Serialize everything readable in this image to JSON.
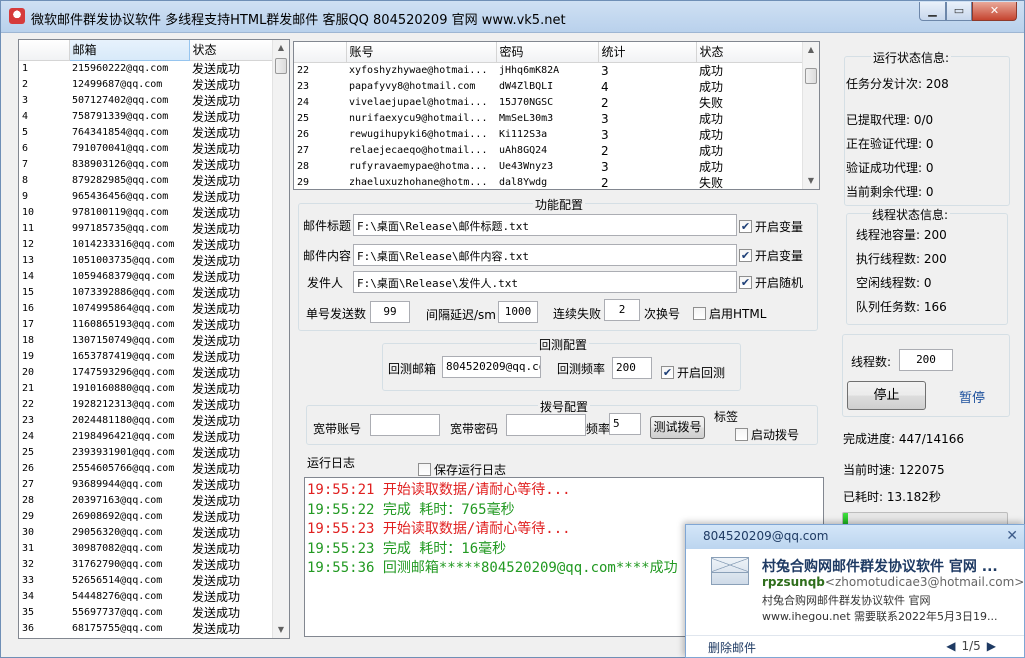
{
  "window": {
    "title": "微软邮件群发协议软件 多线程支持HTML群发邮件 客服QQ 804520209 官网 www.vk5.net"
  },
  "left_list": {
    "columns": [
      "",
      "邮箱",
      "状态"
    ],
    "rows": [
      [
        "1",
        "215960222@qq.com",
        "发送成功"
      ],
      [
        "2",
        "12499687@qq.com",
        "发送成功"
      ],
      [
        "3",
        "507127402@qq.com",
        "发送成功"
      ],
      [
        "4",
        "758791339@qq.com",
        "发送成功"
      ],
      [
        "5",
        "764341854@qq.com",
        "发送成功"
      ],
      [
        "6",
        "791070041@qq.com",
        "发送成功"
      ],
      [
        "7",
        "838903126@qq.com",
        "发送成功"
      ],
      [
        "8",
        "879282985@qq.com",
        "发送成功"
      ],
      [
        "9",
        "965436456@qq.com",
        "发送成功"
      ],
      [
        "10",
        "978100119@qq.com",
        "发送成功"
      ],
      [
        "11",
        "997185735@qq.com",
        "发送成功"
      ],
      [
        "12",
        "1014233316@qq.com",
        "发送成功"
      ],
      [
        "13",
        "1051003735@qq.com",
        "发送成功"
      ],
      [
        "14",
        "1059468379@qq.com",
        "发送成功"
      ],
      [
        "15",
        "1073392886@qq.com",
        "发送成功"
      ],
      [
        "16",
        "1074995864@qq.com",
        "发送成功"
      ],
      [
        "17",
        "1160865193@qq.com",
        "发送成功"
      ],
      [
        "18",
        "1307150749@qq.com",
        "发送成功"
      ],
      [
        "19",
        "1653787419@qq.com",
        "发送成功"
      ],
      [
        "20",
        "1747593296@qq.com",
        "发送成功"
      ],
      [
        "21",
        "1910160880@qq.com",
        "发送成功"
      ],
      [
        "22",
        "1928212313@qq.com",
        "发送成功"
      ],
      [
        "23",
        "2024481180@qq.com",
        "发送成功"
      ],
      [
        "24",
        "2198496421@qq.com",
        "发送成功"
      ],
      [
        "25",
        "2393931901@qq.com",
        "发送成功"
      ],
      [
        "26",
        "2554605766@qq.com",
        "发送成功"
      ],
      [
        "27",
        "93689944@qq.com",
        "发送成功"
      ],
      [
        "28",
        "20397163@qq.com",
        "发送成功"
      ],
      [
        "29",
        "26908692@qq.com",
        "发送成功"
      ],
      [
        "30",
        "29056320@qq.com",
        "发送成功"
      ],
      [
        "31",
        "30987082@qq.com",
        "发送成功"
      ],
      [
        "32",
        "31762790@qq.com",
        "发送成功"
      ],
      [
        "33",
        "52656514@qq.com",
        "发送成功"
      ],
      [
        "34",
        "54448276@qq.com",
        "发送成功"
      ],
      [
        "35",
        "55697737@qq.com",
        "发送成功"
      ],
      [
        "36",
        "68175755@qq.com",
        "发送成功"
      ]
    ]
  },
  "account_list": {
    "columns": [
      "",
      "账号",
      "密码",
      "统计",
      "状态"
    ],
    "rows": [
      [
        "22",
        "xyfoshyzhywae@hotmai...",
        "jHhq6mK82A",
        "3",
        "成功"
      ],
      [
        "23",
        "papafyvy8@hotmail.com",
        "dW4ZlBQLI",
        "4",
        "成功"
      ],
      [
        "24",
        "vivelaejupael@hotmai...",
        "15J70NGSC",
        "2",
        "失败"
      ],
      [
        "25",
        "nurifaexycu9@hotmail...",
        "MmSeL30m3",
        "3",
        "成功"
      ],
      [
        "26",
        "rewugihupyki6@hotmai...",
        "Ki112S3a",
        "3",
        "成功"
      ],
      [
        "27",
        "relaejecaeqo@hotmail...",
        "uAh8GQ24",
        "2",
        "成功"
      ],
      [
        "28",
        "rufyravaemypae@hotma...",
        "Ue43Wnyz3",
        "3",
        "成功"
      ],
      [
        "29",
        "zhaeluxuzhohane@hotm...",
        "dal8Ywdg",
        "2",
        "失败"
      ]
    ]
  },
  "func_config": {
    "title": "功能配置",
    "subject_label": "邮件标题",
    "subject_path": "F:\\桌面\\Release\\邮件标题.txt",
    "subject_var": "开启变量",
    "content_label": "邮件内容",
    "content_path": "F:\\桌面\\Release\\邮件内容.txt",
    "content_var": "开启变量",
    "sender_label": "发件人",
    "sender_path": "F:\\桌面\\Release\\发件人.txt",
    "sender_rand": "开启随机",
    "single_send_label": "单号发送数",
    "single_send_value": "99",
    "interval_label": "间隔延迟/sm",
    "interval_value": "1000",
    "fail_label": "连续失败",
    "fail_value": "2",
    "switch_label": "次换号",
    "html_label": "启用HTML"
  },
  "return_config": {
    "title": "回测配置",
    "email_label": "回测邮箱",
    "email_value": "804520209@qq.com",
    "freq_label": "回测频率",
    "freq_value": "200",
    "enable_label": "开启回测"
  },
  "dial_config": {
    "title": "拨号配置",
    "account_label": "宽带账号",
    "account_value": "",
    "password_label": "宽带密码",
    "password_value": "",
    "freq_label": "频率",
    "freq_value": "5",
    "test_button": "测试拨号",
    "tag_label": "标签",
    "enable_label": "启动拨号"
  },
  "log": {
    "title": "运行日志",
    "save_label": "保存运行日志",
    "lines": [
      {
        "text": "19:55:21 开始读取数据/请耐心等待...",
        "color": "#e02020"
      },
      {
        "text": "19:55:22 完成 耗时：765毫秒",
        "color": "#229922"
      },
      {
        "text": "19:55:23 开始读取数据/请耐心等待...",
        "color": "#e02020"
      },
      {
        "text": "19:55:23 完成 耗时：16毫秒",
        "color": "#229922"
      },
      {
        "text": "19:55:36 回测邮箱*****804520209@qq.com****成功",
        "color": "#229922"
      }
    ]
  },
  "run_status": {
    "title": "运行状态信息:",
    "dispatch": "任务分发计次: 208",
    "proxy_fetched": "已提取代理: 0/0",
    "proxy_verifying": "正在验证代理: 0",
    "proxy_ok": "验证成功代理: 0",
    "proxy_left": "当前剩余代理: 0"
  },
  "thread_status": {
    "title": "线程状态信息:",
    "pool": "线程池容量: 200",
    "running": "执行线程数: 200",
    "idle": "空闲线程数: 0",
    "queue": "队列任务数: 166"
  },
  "controls": {
    "threads_label": "线程数:",
    "threads_value": "200",
    "stop_button": "停止",
    "pause_link": "暂停",
    "progress_text": "完成进度: 447/14166",
    "speed_text": "当前时速: 122075",
    "elapsed_text": "已耗时: 13.182秒",
    "progress_fraction": 0.0316
  },
  "toast": {
    "header": "804520209@qq.com",
    "subject": "村兔合购网邮件群发协议软件 官网 ...",
    "from_name": "rpzsunqb",
    "from_addr": "<zhomotudicae3@hotmail.com>",
    "body1": "村兔合购网邮件群发协议软件 官网",
    "body2": "www.ihegou.net 需要联系2022年5月3日19...",
    "delete": "删除邮件",
    "page": "1/5"
  },
  "colors": {
    "accent": "#1c4f9c",
    "success": "#229922",
    "error": "#e02020"
  }
}
